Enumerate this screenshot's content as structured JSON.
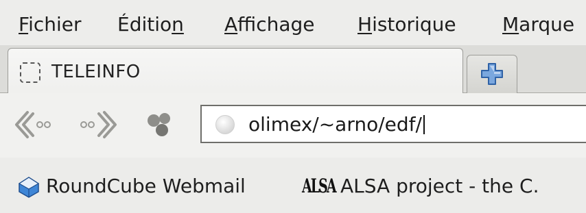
{
  "menu": {
    "items": [
      {
        "label": "Fichier",
        "accel_index": 0
      },
      {
        "label": "Édition",
        "accel_index": 6
      },
      {
        "label": "Affichage",
        "accel_index": 0
      },
      {
        "label": "Historique",
        "accel_index": 0
      },
      {
        "label": "Marque",
        "accel_index": 0
      }
    ]
  },
  "tabs": {
    "active": {
      "title": "TELEINFO",
      "favicon": "dashed-square-icon"
    },
    "new_tab_icon": "plus-icon"
  },
  "navigation": {
    "back_icon": "back-arrow-icon",
    "forward_icon": "forward-arrow-icon",
    "feed_icon": "molecule-icon",
    "url": "olimex/~arno/edf/",
    "url_icon": "globe-icon"
  },
  "bookmarks": [
    {
      "label": "RoundCube Webmail",
      "icon": "roundcube-icon"
    },
    {
      "label": "ALSA project - the C.",
      "icon": "alsa-logo-icon",
      "logo_text": "ALSA"
    }
  ]
}
